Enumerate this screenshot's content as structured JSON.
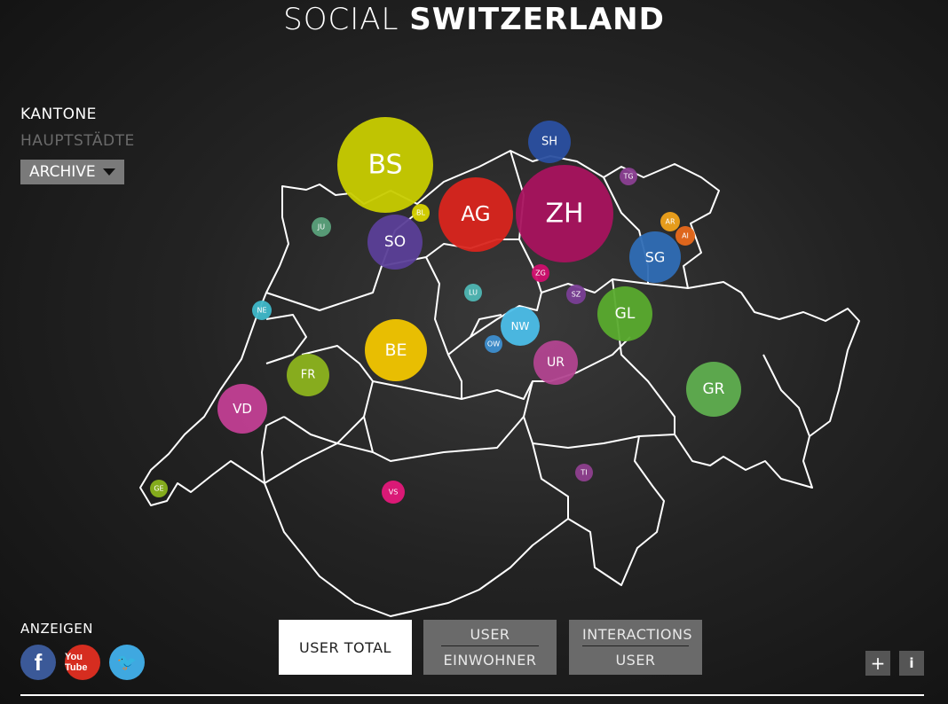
{
  "header": {
    "title_light": "SOCIAL",
    "title_bold": "SWITZERLAND"
  },
  "sidebar": {
    "kantone": "KANTONE",
    "hauptstaedte": "HAUPTSTÄDTE",
    "archive": "ARCHIVE"
  },
  "cantons": [
    {
      "code": "BS",
      "color": "#c8cc00"
    },
    {
      "code": "SH",
      "color": "#2a4fa0"
    },
    {
      "code": "TG",
      "color": "#8a3f91"
    },
    {
      "code": "AG",
      "color": "#d9251e"
    },
    {
      "code": "ZH",
      "color": "#a8135e"
    },
    {
      "code": "BL",
      "color": "#d8d400"
    },
    {
      "code": "JU",
      "color": "#5aa07a"
    },
    {
      "code": "SO",
      "color": "#5b3f98"
    },
    {
      "code": "AR",
      "color": "#f0a21a"
    },
    {
      "code": "AI",
      "color": "#e8691b"
    },
    {
      "code": "SG",
      "color": "#2f6db5"
    },
    {
      "code": "ZG",
      "color": "#d10f6e"
    },
    {
      "code": "LU",
      "color": "#4fb7b4"
    },
    {
      "code": "SZ",
      "color": "#7a3f96"
    },
    {
      "code": "GL",
      "color": "#5aab2e"
    },
    {
      "code": "NE",
      "color": "#3fb8c9"
    },
    {
      "code": "NW",
      "color": "#4bbde8"
    },
    {
      "code": "OW",
      "color": "#3d8ecf"
    },
    {
      "code": "BE",
      "color": "#f2c600"
    },
    {
      "code": "UR",
      "color": "#b24490"
    },
    {
      "code": "FR",
      "color": "#8cb31e"
    },
    {
      "code": "GR",
      "color": "#5fae4f"
    },
    {
      "code": "VD",
      "color": "#c23f93"
    },
    {
      "code": "TI",
      "color": "#8e3f8e"
    },
    {
      "code": "GE",
      "color": "#8ab31c"
    },
    {
      "code": "VS",
      "color": "#e4187a"
    }
  ],
  "footer": {
    "show_label": "ANZEIGEN",
    "social": [
      "facebook-icon",
      "youtube-icon",
      "twitter-icon"
    ],
    "youtube_text": "You Tube",
    "btn_user_total": "USER TOTAL",
    "btn_user_top": "USER",
    "btn_user_bottom": "EINWOHNER",
    "btn_inter_top": "INTERACTIONS",
    "btn_inter_bottom": "USER",
    "plus": "+",
    "info": "i"
  }
}
